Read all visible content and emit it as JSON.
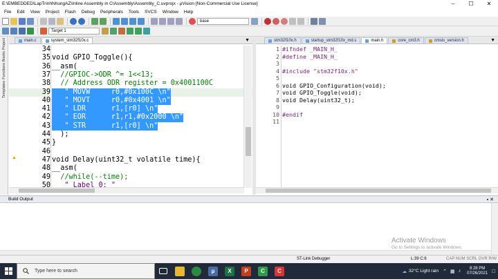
{
  "window": {
    "title": "E:\\EMBEDDED\\LapTrinhNhungAZ\\Inline Assembly in C\\Assembly\\Assembly_C.uvprojx - µVision  [Non-Commercial Use License]"
  },
  "menu": [
    "File",
    "Edit",
    "View",
    "Project",
    "Flash",
    "Debug",
    "Peripherals",
    "Tools",
    "SVCS",
    "Window",
    "Help"
  ],
  "toolbar": {
    "combo_text": "base",
    "target": "Target 1"
  },
  "left_pane": {
    "tabs": [
      "Project",
      "Books",
      "Functions",
      "Templates"
    ]
  },
  "left_editor": {
    "tabs": [
      {
        "label": "main.c",
        "active": false,
        "edited": false
      },
      {
        "label": "system_stm32f10x.c",
        "active": true,
        "edited": false
      }
    ],
    "lines": [
      {
        "n": "34",
        "text": ""
      },
      {
        "n": "35",
        "text": "void GPIO_Toggle(){"
      },
      {
        "n": "36",
        "text": "__asm("
      },
      {
        "n": "37",
        "text": "  //GPIOC->ODR ^= 1<<13;"
      },
      {
        "n": "38",
        "text": "  // Address ODR register = 0x4001100C"
      },
      {
        "n": "39",
        "text": "   \" MOVW     r0,#0x100C \\n\""
      },
      {
        "n": "40",
        "text": "   \" MOVT     r0,#0x4001 \\n\""
      },
      {
        "n": "41",
        "text": "   \" LDR      r1,[r0] \\n\""
      },
      {
        "n": "42",
        "text": "   \" EOR      r1,r1,#0x2000 \\n\""
      },
      {
        "n": "43",
        "text": "   \" STR      r1,[r0] \\n\""
      },
      {
        "n": "44",
        "text": "  );"
      },
      {
        "n": "45",
        "text": "}"
      },
      {
        "n": "46",
        "text": ""
      },
      {
        "n": "47",
        "text": "void Delay(uint32_t volatile time){"
      },
      {
        "n": "48",
        "text": "__asm("
      },
      {
        "n": "49",
        "text": "  //while(--time);"
      },
      {
        "n": "50",
        "text": "   \" Label 0: \""
      }
    ]
  },
  "right_editor": {
    "tabs": [
      {
        "label": "stm32f10x.h",
        "active": false,
        "edited": false
      },
      {
        "label": "startup_stm32f10x_md.s",
        "active": false,
        "edited": false
      },
      {
        "label": "main.h",
        "active": true,
        "edited": false
      },
      {
        "label": "core_cm3.h",
        "active": false,
        "edited": true
      },
      {
        "label": "cmsis_version.h",
        "active": false,
        "edited": true
      }
    ],
    "lines": [
      {
        "n": "1",
        "text": "#ifndef _MAIN_H_"
      },
      {
        "n": "2",
        "text": "#define _MAIN_H_"
      },
      {
        "n": "3",
        "text": ""
      },
      {
        "n": "4",
        "text": "#include \"stm32f10x.h\""
      },
      {
        "n": "5",
        "text": ""
      },
      {
        "n": "6",
        "text": "void GPIO_Configuration(void);"
      },
      {
        "n": "7",
        "text": "void GPIO_Toggle(void);"
      },
      {
        "n": "8",
        "text": "void Delay(uint32_t);"
      },
      {
        "n": "9",
        "text": ""
      },
      {
        "n": "10",
        "text": "#endif"
      },
      {
        "n": "11",
        "text": ""
      }
    ]
  },
  "build_output": {
    "title": "Build Output",
    "watermark_line1": "Activate Windows",
    "watermark_line2": "Go to Settings to activate Windows."
  },
  "status_bar": {
    "debugger": "ST-Link Debugger",
    "position": "L:39 C:6",
    "indicators": "CAP  NUM  SCRL  OVR  R/W"
  },
  "taskbar": {
    "search_placeholder": "Type here to search",
    "weather": "32°C  Light rain",
    "time": "8:28 PM",
    "date": "07/26/2021"
  },
  "colors": {
    "selection": "#3399ff",
    "comment": "#008000",
    "string": "#6a0080",
    "taskbar": "#202a3a"
  }
}
